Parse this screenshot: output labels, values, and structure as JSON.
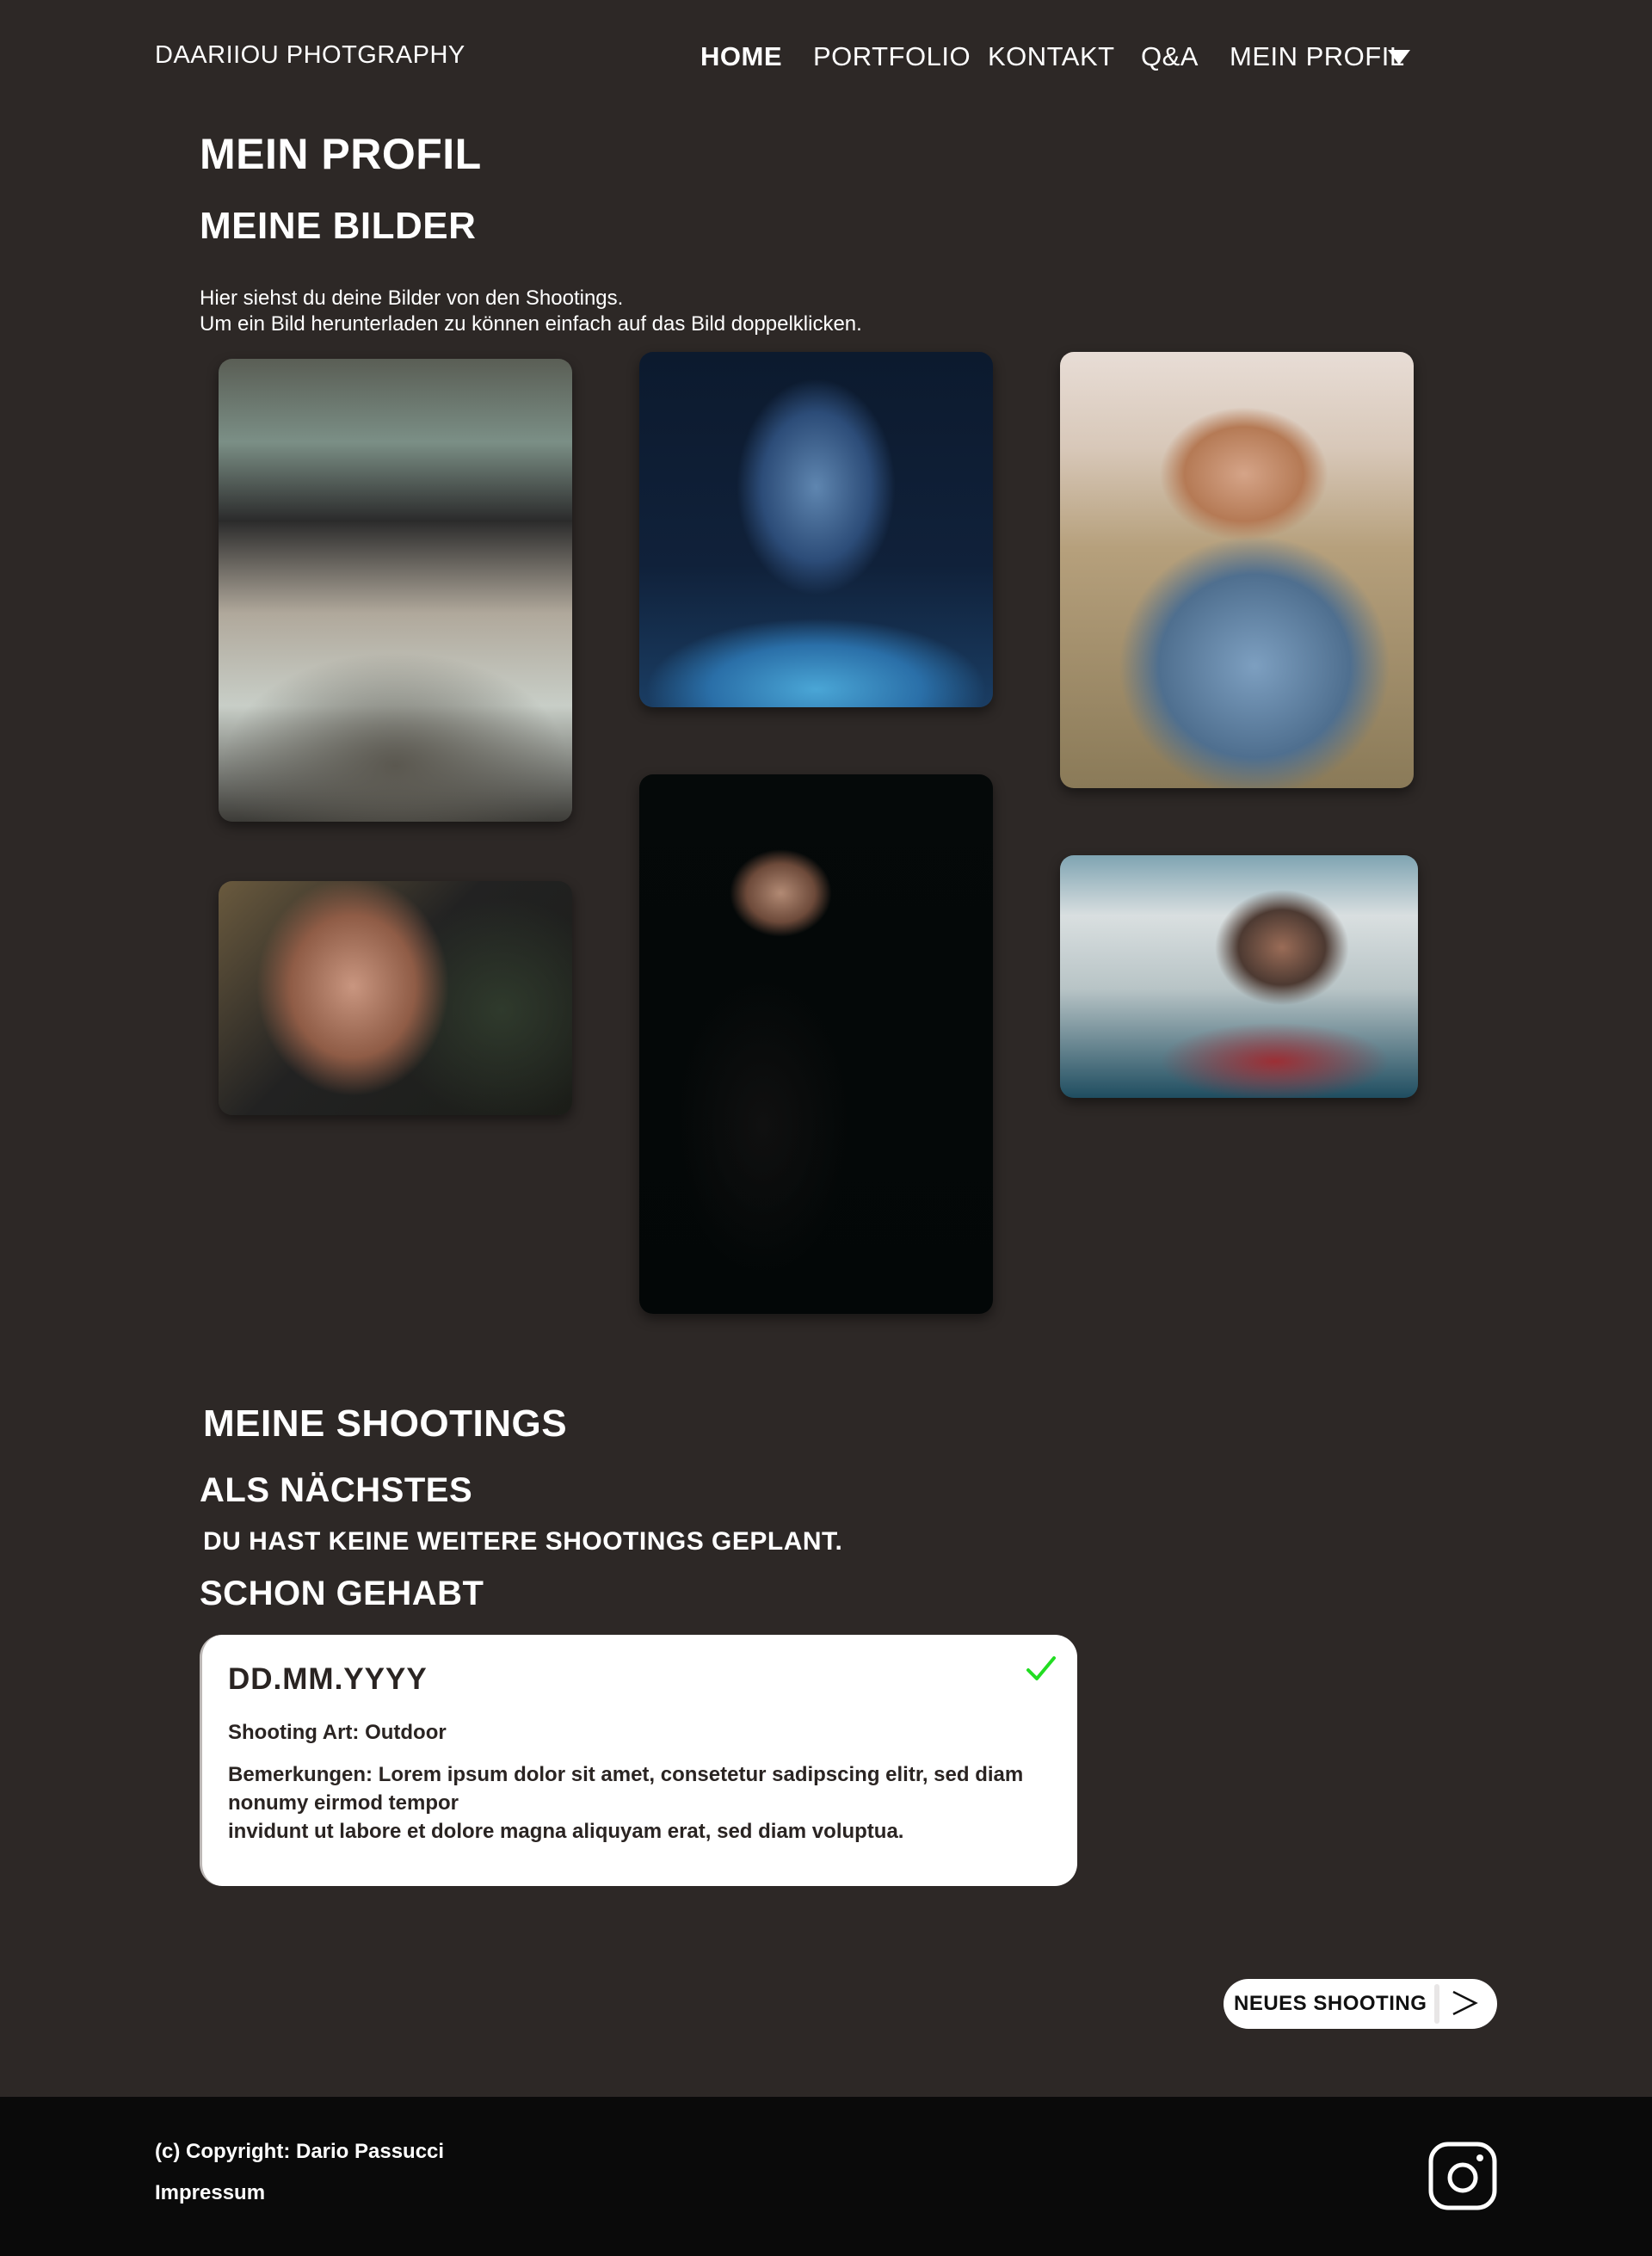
{
  "header": {
    "brand": "DAARIIOU PHOTGRAPHY",
    "nav": {
      "home": "HOME",
      "portfolio": "PORTFOLIO",
      "kontakt": "KONTAKT",
      "qa": "Q&A",
      "profil": "MEIN PROFIL"
    }
  },
  "page_title": "MEIN PROFIL",
  "bilder": {
    "title": "MEINE BILDER",
    "intro_line1": "Hier siehst du deine Bilder von den Shootings.",
    "intro_line2": "Um ein Bild herunterladen zu können einfach auf das Bild doppelklicken."
  },
  "shootings": {
    "title": "MEINE SHOOTINGS",
    "next_title": "ALS NÄCHSTES",
    "next_empty": "DU HAST KEINE WEITERE SHOOTINGS GEPLANT.",
    "past_title": "SCHON GEHABT",
    "past": [
      {
        "date": "DD.MM.YYYY",
        "art": "Shooting Art: Outdoor",
        "bemerkung_line1": "Bemerkungen: Lorem ipsum dolor sit amet, consetetur sadipscing elitr, sed diam nonumy eirmod tempor",
        "bemerkung_line2": "invidunt ut labore et dolore magna aliquyam erat, sed diam voluptua.",
        "status_icon": "checkmark-icon",
        "status_color": "#22dd22"
      }
    ]
  },
  "new_shooting_button": {
    "label": "NEUES SHOOTING",
    "icon": "arrow-right-icon"
  },
  "footer": {
    "copyright": "(c) Copyright: Dario Passucci",
    "impressum": "Impressum",
    "social_icon": "instagram-icon"
  },
  "colors": {
    "background": "#2d2826",
    "footer": "#0a0a0a",
    "card": "#ffffff",
    "check": "#22dd22"
  }
}
